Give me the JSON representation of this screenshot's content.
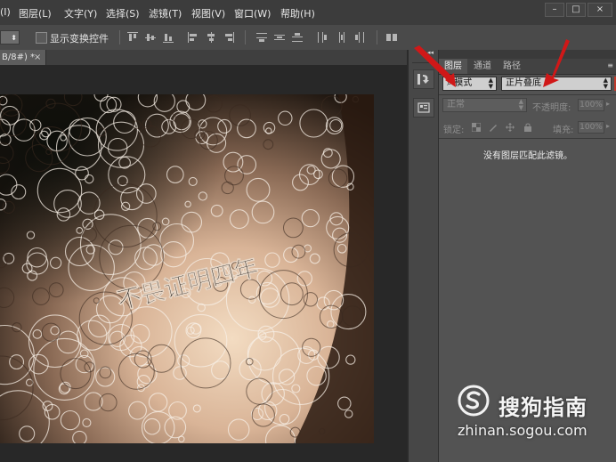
{
  "menubar": {
    "items": [
      "(I)",
      "图层(L)",
      "文字(Y)",
      "选择(S)",
      "滤镜(T)",
      "视图(V)",
      "窗口(W)",
      "帮助(H)"
    ],
    "window_controls": [
      "–",
      "□",
      "×"
    ]
  },
  "options_bar": {
    "show_transform_controls_label": "显示变换控件",
    "show_transform_controls_checked": false
  },
  "document": {
    "tab_title": "B/8#) *",
    "close_symbol": "×",
    "canvas_text": "不畏证明四年"
  },
  "layers_panel": {
    "collapse_symbol": "◂◂",
    "tabs": [
      "图层",
      "通道",
      "路径"
    ],
    "active_tab": "图层",
    "filter_type": "模式",
    "filter_mode_value": "正片叠底",
    "blend_mode": "正常",
    "opacity_label": "不透明度:",
    "opacity_value": "100%",
    "lock_label": "锁定:",
    "fill_label": "填充:",
    "fill_value": "100%",
    "empty_message": "没有图层匹配此滤镜。"
  },
  "watermark": {
    "name": "搜狗指南",
    "url": "zhinan.sogou.com"
  },
  "colors": {
    "annotation_arrow": "#d01818"
  }
}
